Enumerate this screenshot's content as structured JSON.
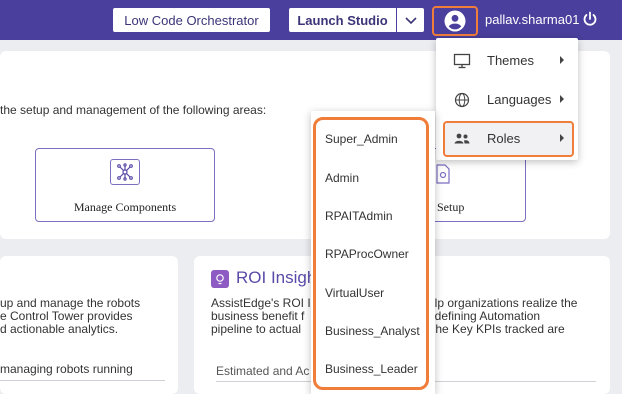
{
  "header": {
    "low_code_button": "Low Code Orchestrator",
    "launch_studio_button": "Launch Studio",
    "username": "pallav.sharma01",
    "colors": {
      "bar": "#4a3f9c",
      "highlight": "#f07d3a"
    }
  },
  "main": {
    "intro": "the setup and management of the following areas:",
    "tiles": [
      {
        "label": "Manage Components",
        "icon": "network-icon"
      },
      {
        "label": "Setup",
        "icon": "settings-doc-icon"
      }
    ],
    "left_card": {
      "lines": [
        "up and manage the robots",
        "e Control Tower provides",
        "d actionable analytics."
      ],
      "sub": "managing robots running"
    },
    "roi_card": {
      "title": "ROI Insigh",
      "lines_left": [
        "AssistEdge's ROI I",
        "business benefit f",
        "pipeline to actual"
      ],
      "lines_right": [
        "elp organizations realize the",
        ", defining Automation",
        "The Key KPIs tracked are"
      ],
      "estimated_label": "Estimated and Ac"
    }
  },
  "user_menu": {
    "items": [
      {
        "label": "Themes",
        "icon": "monitor-icon"
      },
      {
        "label": "Languages",
        "icon": "globe-icon"
      },
      {
        "label": "Roles",
        "icon": "people-icon"
      }
    ]
  },
  "roles_submenu": {
    "items": [
      "Super_Admin",
      "Admin",
      "RPAITAdmin",
      "RPAProcOwner",
      "VirtualUser",
      "Business_Analyst",
      "Business_Leader"
    ]
  }
}
